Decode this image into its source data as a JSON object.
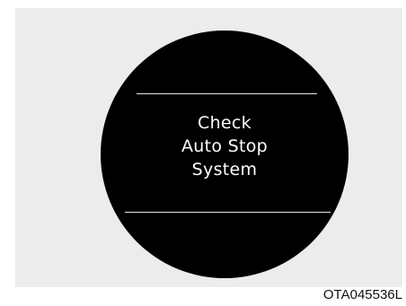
{
  "display": {
    "message_lines": [
      "Check",
      "Auto Stop",
      "System"
    ]
  },
  "figure": {
    "code": "OTA045536L"
  },
  "colors": {
    "panel_background": "#ececec",
    "display_background": "#000000",
    "text": "#ffffff",
    "divider": "#e6e6e6"
  }
}
